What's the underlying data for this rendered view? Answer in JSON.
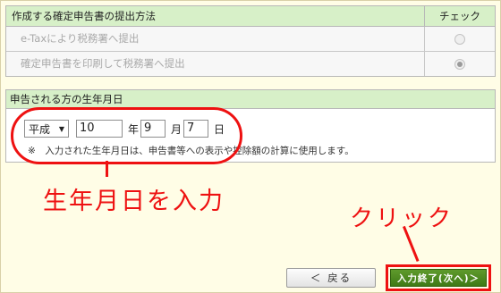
{
  "method_table": {
    "header_label": "作成する確定申告書の提出方法",
    "header_check": "チェック",
    "options": [
      {
        "label": "e-Taxにより税務署へ提出",
        "checked": false
      },
      {
        "label": "確定申告書を印刷して税務署へ提出",
        "checked": true
      }
    ]
  },
  "birthdate": {
    "header": "申告される方の生年月日",
    "era": "平成",
    "year": "10",
    "year_unit": "年",
    "month": "9",
    "month_unit": "月",
    "day": "7",
    "day_unit": "日",
    "note": "※　入力された生年月日は、申告書等への表示や控除額の計算に使用します。"
  },
  "annotations": {
    "enter_birthdate": "生年月日を入力",
    "click": "クリック",
    "color": "#ee1111"
  },
  "buttons": {
    "back": "＜ 戻る",
    "next": "入力終了(次へ)＞"
  },
  "icons": {
    "dropdown": "chevron-down-icon",
    "radio": "radio-icon"
  }
}
